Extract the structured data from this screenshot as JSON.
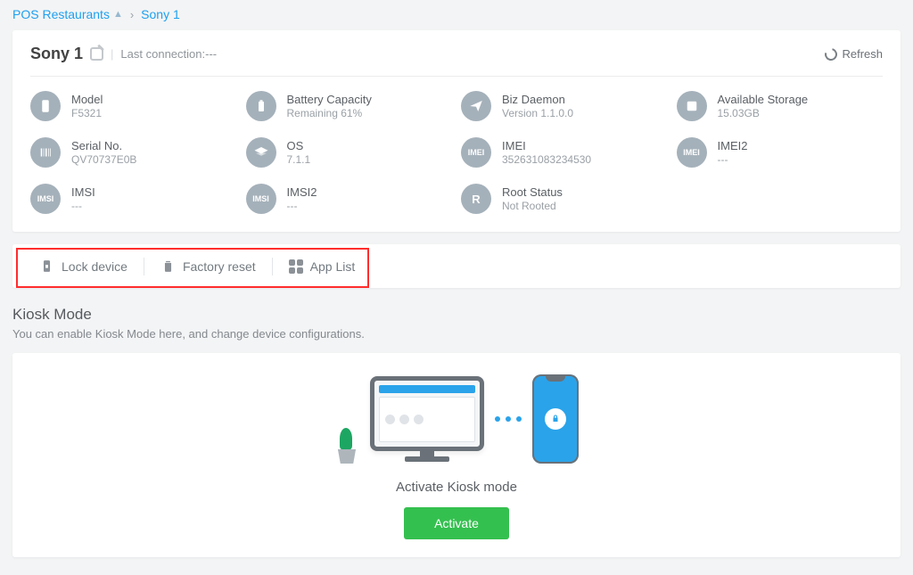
{
  "breadcrumb": {
    "group": "POS Restaurants",
    "device": "Sony 1"
  },
  "header": {
    "device_name": "Sony 1",
    "last_conn_label": "Last connection:",
    "last_conn_value": "---",
    "refresh": "Refresh"
  },
  "specs": {
    "model": {
      "label": "Model",
      "value": "F5321"
    },
    "battery": {
      "label": "Battery Capacity",
      "value": "Remaining 61%"
    },
    "biz": {
      "label": "Biz Daemon",
      "value": "Version 1.1.0.0"
    },
    "storage": {
      "label": "Available Storage",
      "value": "15.03GB"
    },
    "serial": {
      "label": "Serial No.",
      "value": "QV70737E0B"
    },
    "os": {
      "label": "OS",
      "value": "7.1.1"
    },
    "imei": {
      "label": "IMEI",
      "value": "352631083234530"
    },
    "imei2": {
      "label": "IMEI2",
      "value": "---"
    },
    "imsi": {
      "label": "IMSI",
      "value": "---"
    },
    "imsi2": {
      "label": "IMSI2",
      "value": "---"
    },
    "root": {
      "label": "Root Status",
      "value": "Not Rooted"
    }
  },
  "actions": {
    "lock": "Lock device",
    "factory_reset": "Factory reset",
    "app_list": "App List"
  },
  "kiosk": {
    "title": "Kiosk Mode",
    "subtitle": "You can enable Kiosk Mode here, and change device configurations.",
    "illus_title": "Activate Kiosk mode",
    "button": "Activate"
  }
}
